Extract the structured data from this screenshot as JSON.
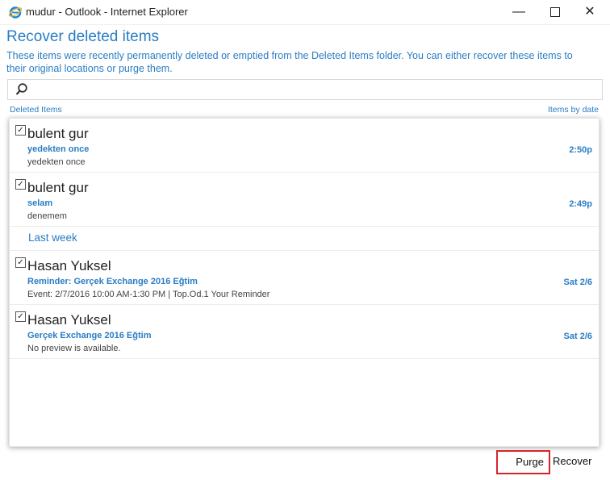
{
  "window": {
    "title": "mudur - Outlook - Internet Explorer",
    "controls": {
      "minimize": "—",
      "maximize": "",
      "close": "✕"
    }
  },
  "dialog": {
    "title": "Recover deleted items",
    "description": "These items were recently permanently deleted or emptied from the Deleted Items folder. You can either recover these items to their original locations or purge them.",
    "folder_label": "Deleted Items",
    "sort_label": "Items by date"
  },
  "items": [
    {
      "sender": "bulent gur",
      "subject": "yedekten once",
      "preview": "yedekten once",
      "time": "2:50p"
    },
    {
      "sender": "bulent gur",
      "subject": "selam",
      "preview": "denemem",
      "time": "2:49p"
    }
  ],
  "group": {
    "title": "Last week"
  },
  "items_last_week": [
    {
      "sender": "Hasan Yuksel",
      "subject": "Reminder: Gerçek Exchange 2016 Eğtim",
      "preview": "Event: 2/7/2016 10:00 AM-1:30 PM | Top.Od.1 Your Reminder",
      "time": "Sat 2/6"
    },
    {
      "sender": "Hasan Yuksel",
      "subject": "Gerçek Exchange 2016 Eğtim",
      "preview": "No preview is available.",
      "time": "Sat 2/6"
    }
  ],
  "actions": {
    "purge": "Purge",
    "recover": "Recover"
  },
  "colors": {
    "accent": "#2a7dc4",
    "highlight": "#d7232a"
  }
}
